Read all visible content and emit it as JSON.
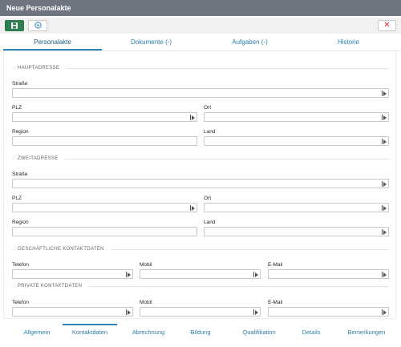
{
  "window": {
    "title": "Neue Personalakte"
  },
  "toolbar": {
    "save_icon": "save-icon",
    "sync_icon": "circle-arrow-icon",
    "close_symbol": "✕"
  },
  "top_tabs": [
    "Personalakte",
    "Dokumente (-)",
    "Aufgaben (-)",
    "Historie"
  ],
  "sections": {
    "hauptadresse": "HAUPTADRESSE",
    "zweitadresse": "ZWEITADRESSE",
    "geschaeftlich": "GESCHÄFTLICHE KONTAKTDATEN",
    "privat": "PRIVATE KONTAKTDATEN"
  },
  "labels": {
    "strasse": "Straße",
    "plz": "PLZ",
    "ort": "Ort",
    "region": "Region",
    "land": "Land",
    "telefon": "Telefon",
    "mobil": "Mobil",
    "email": "E-Mail"
  },
  "bottom_tabs": [
    "Allgemein",
    "Kontaktdaten",
    "Abrechnung",
    "Bildung",
    "Qualifikation",
    "Details",
    "Bemerkungen"
  ],
  "colors": {
    "accent": "#2a86b5",
    "titlebar": "#6f7580",
    "save": "#2e7d4f",
    "close": "#d62c2c"
  }
}
